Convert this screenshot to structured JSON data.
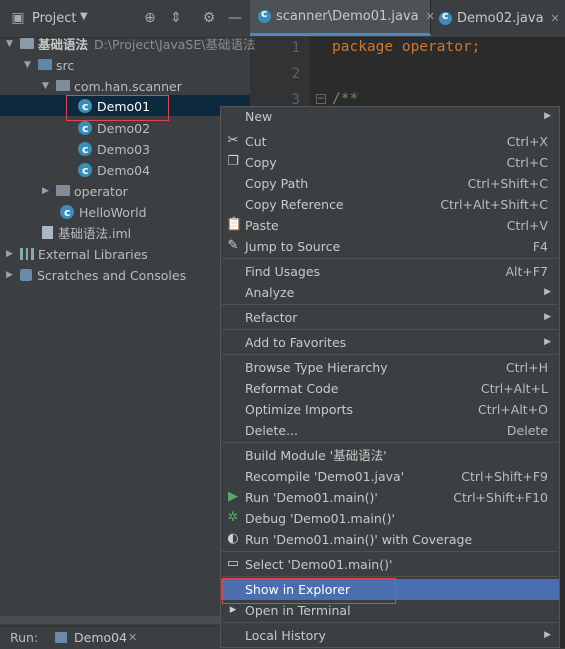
{
  "project_panel": {
    "title": "Project",
    "tree": [
      {
        "label": "基础语法",
        "path": "D:\\Project\\JavaSE\\基础语法"
      },
      {
        "label": "src"
      },
      {
        "label": "com.han.scanner"
      },
      {
        "label": "Demo01",
        "selected": true
      },
      {
        "label": "Demo02"
      },
      {
        "label": "Demo03"
      },
      {
        "label": "Demo04"
      },
      {
        "label": "operator"
      },
      {
        "label": "HelloWorld"
      },
      {
        "label": "基础语法.iml"
      },
      {
        "label": "External Libraries"
      },
      {
        "label": "Scratches and Consoles"
      }
    ]
  },
  "tabs": [
    {
      "label": "scanner\\Demo01.java",
      "active": true
    },
    {
      "label": "Demo02.java"
    }
  ],
  "editor": {
    "lines": [
      {
        "num": "1",
        "code": "package operator;"
      },
      {
        "num": "2",
        "code": ""
      },
      {
        "num": "3",
        "code": "/**"
      }
    ]
  },
  "run_bar": {
    "label": "Run:",
    "tab": "Demo04"
  },
  "context_menu": {
    "items": [
      {
        "label": "New",
        "submenu": true
      },
      {
        "label": "Cut",
        "shortcut": "Ctrl+X",
        "icon": "scissors-icon"
      },
      {
        "label": "Copy",
        "shortcut": "Ctrl+C",
        "icon": "copy-icon"
      },
      {
        "label": "Copy Path",
        "shortcut": "Ctrl+Shift+C"
      },
      {
        "label": "Copy Reference",
        "shortcut": "Ctrl+Alt+Shift+C"
      },
      {
        "label": "Paste",
        "shortcut": "Ctrl+V",
        "icon": "clipboard-icon"
      },
      {
        "label": "Jump to Source",
        "shortcut": "F4",
        "icon": "pencil-icon"
      },
      {
        "label": "Find Usages",
        "shortcut": "Alt+F7"
      },
      {
        "label": "Analyze",
        "submenu": true
      },
      {
        "label": "Refactor",
        "submenu": true
      },
      {
        "label": "Add to Favorites",
        "submenu": true
      },
      {
        "label": "Browse Type Hierarchy",
        "shortcut": "Ctrl+H"
      },
      {
        "label": "Reformat Code",
        "shortcut": "Ctrl+Alt+L"
      },
      {
        "label": "Optimize Imports",
        "shortcut": "Ctrl+Alt+O"
      },
      {
        "label": "Delete...",
        "shortcut": "Delete"
      },
      {
        "label": "Build Module '基础语法'"
      },
      {
        "label": "Recompile 'Demo01.java'",
        "shortcut": "Ctrl+Shift+F9"
      },
      {
        "label": "Run 'Demo01.main()'",
        "shortcut": "Ctrl+Shift+F10",
        "icon": "run-icon"
      },
      {
        "label": "Debug 'Demo01.main()'",
        "icon": "debug-icon"
      },
      {
        "label": "Run 'Demo01.main()' with Coverage",
        "icon": "coverage-icon"
      },
      {
        "label": "Select 'Demo01.main()'",
        "icon": "select-icon"
      },
      {
        "label": "Show in Explorer",
        "highlighted": true
      },
      {
        "label": "Open in Terminal",
        "icon": "terminal-icon"
      },
      {
        "label": "Local History",
        "submenu": true
      }
    ]
  },
  "colors": {
    "highlight": "#4b6eaf",
    "annotation_box": "#e0454f",
    "keyword": "#cc7832",
    "comment": "#629755"
  }
}
